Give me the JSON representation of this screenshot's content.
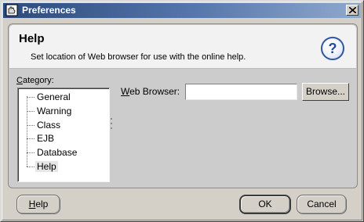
{
  "window": {
    "title": "Preferences",
    "title_icon": "app-hand-icon",
    "close_icon": "close-icon"
  },
  "header": {
    "title": "Help",
    "subtitle": "Set location of Web browser for use with the online help.",
    "help_glyph": "?"
  },
  "category": {
    "label_mnemonic": "C",
    "label_rest": "ategory:",
    "items": [
      {
        "label": "General",
        "selected": false
      },
      {
        "label": "Warning",
        "selected": false
      },
      {
        "label": "Class",
        "selected": false
      },
      {
        "label": "EJB",
        "selected": false
      },
      {
        "label": "Database",
        "selected": false
      },
      {
        "label": "Help",
        "selected": true
      }
    ]
  },
  "web_browser": {
    "label_mnemonic": "W",
    "label_rest": "eb Browser:",
    "value": "",
    "browse_label": "Browse..."
  },
  "footer": {
    "help_mnemonic": "H",
    "help_rest": "elp",
    "ok_label": "OK",
    "cancel_label": "Cancel"
  },
  "colors": {
    "title_bar_start": "#2b4a7e",
    "title_bar_end": "#8fa9cf",
    "dialog_bg": "#d4d0c8",
    "panel_bg": "#cccccc",
    "help_icon_blue": "#2447a0"
  }
}
